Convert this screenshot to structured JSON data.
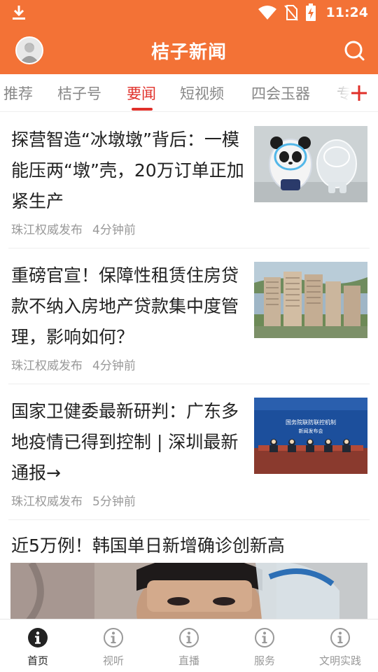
{
  "status_bar": {
    "time": "11:24",
    "icons": [
      "download-icon",
      "wifi-icon",
      "no-sim-icon",
      "battery-charging-icon"
    ]
  },
  "header": {
    "title": "桔子新闻",
    "avatar_icon": "user-avatar",
    "search_icon": "search-icon",
    "color": "#f37236"
  },
  "tabs": {
    "items": [
      "推荐",
      "桔子号",
      "要闻",
      "短视频",
      "四会玉器",
      "专"
    ],
    "active_index": 2,
    "active_color": "#e0302a",
    "add_icon": "plus-icon"
  },
  "news": [
    {
      "title": "探营智造“冰墩墩”背后：一模能压两“墩”壳，20万订单正加紧生产",
      "source": "珠江权威发布",
      "time": "4分钟前"
    },
    {
      "title": "重磅官宣！保障性租赁住房贷款不纳入房地产贷款集中度管理，影响如何？",
      "source": "珠江权威发布",
      "time": "4分钟前"
    },
    {
      "title": "国家卫健委最新研判：广东多地疫情已得到控制 | 深圳最新通报→",
      "source": "珠江权威发布",
      "time": "5分钟前"
    },
    {
      "title": "近5万例！韩国单日新增确诊创新高"
    }
  ],
  "thumb_text": {
    "press_banner_1": "国务院联防联控机制",
    "press_banner_2": "新闻发布会"
  },
  "bottom_nav": {
    "items": [
      "首页",
      "视听",
      "直播",
      "服务",
      "文明实践"
    ],
    "active_index": 0
  }
}
